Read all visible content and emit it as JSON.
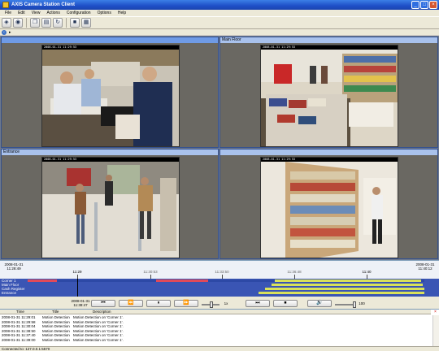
{
  "window": {
    "title": "AXIS Camera Station Client"
  },
  "menu": [
    "File",
    "Edit",
    "View",
    "Actions",
    "Configuration",
    "Options",
    "Help"
  ],
  "views": [
    {
      "header": "",
      "stamp": "2008-01-31 11:29:53"
    },
    {
      "header": "Main Floor",
      "stamp": "2008-01-31 11:29:53"
    },
    {
      "header": "Entrance",
      "stamp": "2008-01-31 11:29:53"
    },
    {
      "header": "",
      "stamp": "2008-01-31 11:29:53"
    }
  ],
  "timeline": {
    "start_label": "2008-01-31\n11:28:49",
    "end_label": "2008-01-31\n11:40:12",
    "ticks": [
      "11:29",
      "11:30:53",
      "11:33:50",
      "11:36:48",
      "11:40"
    ],
    "current_label": "2008-01-31\n11:38:47",
    "rows": [
      "Corner 1",
      "Main Floor",
      "Cash Register",
      "Entrance"
    ]
  },
  "playback": {
    "speed_label": "1x",
    "volume_label": "100",
    "buttons": [
      "⏮",
      "⏪",
      "⏸",
      "⏩",
      "⏭",
      "⏹",
      "🔊"
    ]
  },
  "log": {
    "columns": [
      "Time",
      "Title",
      "Description"
    ],
    "rows": [
      {
        "time": "2008-01-31 11:29:01",
        "title": "Motion Detection",
        "desc": "Motion Detection on 'Corner 1'."
      },
      {
        "time": "2008-01-31 11:29:58",
        "title": "Motion Detection",
        "desc": "Motion Detection on 'Corner 1'."
      },
      {
        "time": "2008-01-31 11:30:04",
        "title": "Motion Detection",
        "desc": "Motion Detection on 'Corner 1'."
      },
      {
        "time": "2008-01-31 11:38:50",
        "title": "Motion Detection",
        "desc": "Motion Detection on 'Corner 1'."
      },
      {
        "time": "2008-01-31 11:37:40",
        "title": "Motion Detection",
        "desc": "Motion Detection on 'Corner 1'."
      },
      {
        "time": "2008-01-31 11:39:00",
        "title": "Motion Detection",
        "desc": "Motion Detection on 'Corner 1'."
      }
    ]
  },
  "status": {
    "text": "Connected to: 127.0.0.1:5570"
  }
}
